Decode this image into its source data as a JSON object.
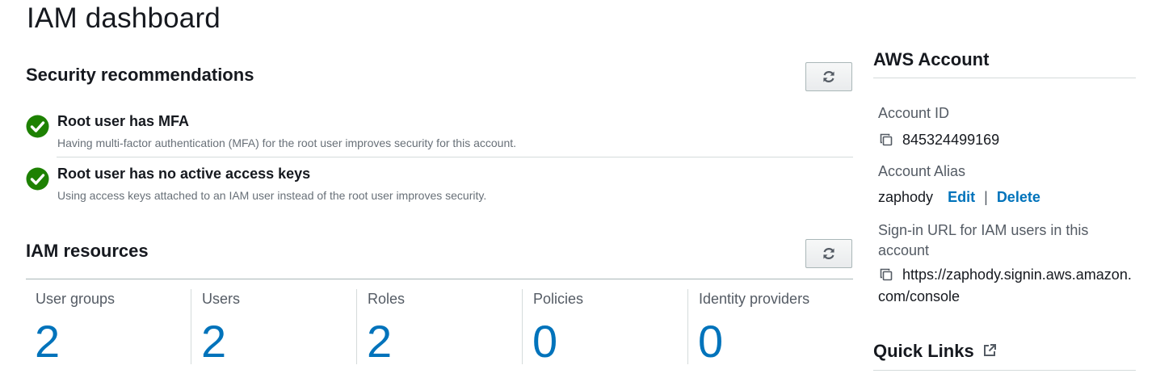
{
  "page": {
    "title": "IAM dashboard"
  },
  "security": {
    "heading": "Security recommendations",
    "items": [
      {
        "title": "Root user has MFA",
        "description": "Having multi-factor authentication (MFA) for the root user improves security for this account.",
        "status": "success"
      },
      {
        "title": "Root user has no active access keys",
        "description": "Using access keys attached to an IAM user instead of the root user improves security.",
        "status": "success"
      }
    ]
  },
  "resources": {
    "heading": "IAM resources",
    "items": [
      {
        "label": "User groups",
        "count": "2"
      },
      {
        "label": "Users",
        "count": "2"
      },
      {
        "label": "Roles",
        "count": "2"
      },
      {
        "label": "Policies",
        "count": "0"
      },
      {
        "label": "Identity providers",
        "count": "0"
      }
    ]
  },
  "account": {
    "heading": "AWS Account",
    "id_label": "Account ID",
    "id_value": "845324499169",
    "alias_label": "Account Alias",
    "alias_value": "zaphody",
    "edit_label": "Edit",
    "separator": "|",
    "delete_label": "Delete",
    "signin_label": "Sign-in URL for IAM users in this account",
    "signin_url_line1": "https://zaphody.signin.aws.amazon.",
    "signin_url_line2": "com/console"
  },
  "quick_links": {
    "heading": "Quick Links"
  },
  "colors": {
    "link": "#0073bb",
    "success": "#1d8102",
    "text": "#16191f",
    "muted": "#687078"
  },
  "icons": {
    "refresh": "refresh-icon",
    "check": "check-circle-icon",
    "copy": "copy-icon",
    "external": "external-link-icon"
  }
}
